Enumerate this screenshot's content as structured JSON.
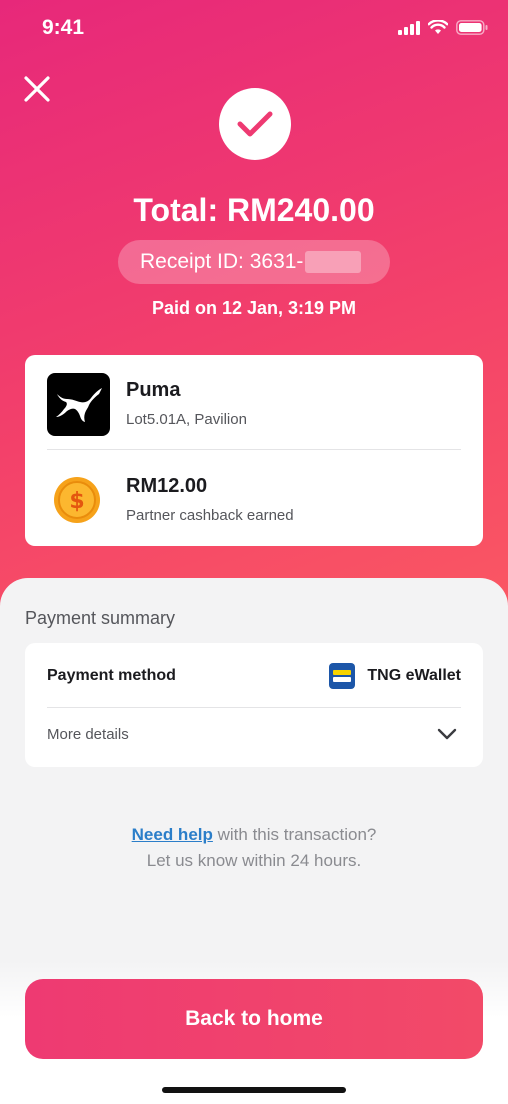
{
  "status_bar": {
    "time": "9:41"
  },
  "header": {
    "total": "Total: RM240.00",
    "receipt_id": "Receipt ID: 3631-",
    "paid_on": "Paid on 12 Jan, 3:19 PM"
  },
  "merchant": {
    "name": "Puma",
    "location": "Lot5.01A, Pavilion",
    "cashback_amount": "RM12.00",
    "cashback_label": "Partner cashback earned"
  },
  "payment_summary": {
    "title": "Payment summary",
    "method_label": "Payment method",
    "method_value": "TNG eWallet",
    "more_details": "More details"
  },
  "help": {
    "link": "Need help",
    "rest": " with this transaction?",
    "line2": "Let us know within 24 hours."
  },
  "actions": {
    "back_home": "Back to home"
  },
  "colors": {
    "accent": "#f24a68",
    "gradient_start": "#e7287a",
    "gradient_end": "#fb5962",
    "link": "#2b7ec9"
  }
}
